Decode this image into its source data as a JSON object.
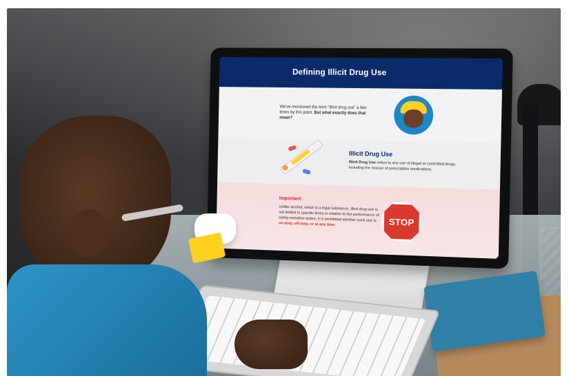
{
  "scene": {
    "alt": ""
  },
  "screen": {
    "header_title": "Defining Illicit Drug Use",
    "sec1": {
      "text_before_bold": "We've mentioned the term \"illicit drug use\" a few times by this point.",
      "text_bold": "But what exactly does that mean?"
    },
    "sec2": {
      "title": "Illicit Drug Use",
      "bold_lead": "Illicit Drug Use",
      "text": " refers to any use of illegal or controlled drugs, including the misuse of prescription medications."
    },
    "sec3": {
      "title": "Important:",
      "text": "Unlike alcohol, which is a legal substance, illicit drug use is not limited to specific times in relation to the performance of safety-sensitive duties; it is prohibited whether such use is",
      "emphasis": "on-duty, off-duty, or at any time."
    },
    "stop_sign_text": "STOP"
  }
}
